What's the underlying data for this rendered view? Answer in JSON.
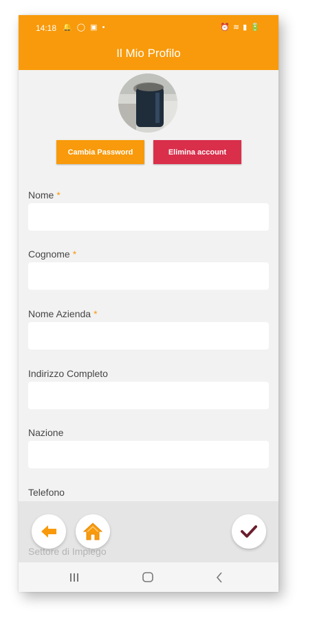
{
  "status_bar": {
    "time": "14:18",
    "left_icons": "🔔 ◯ ▣ •",
    "right_icons": "⏰ ≋ ▮ 🔋"
  },
  "header": {
    "title": "Il Mio Profilo"
  },
  "profile": {
    "change_password_label": "Cambia Password",
    "delete_account_label": "Elimina account"
  },
  "form": {
    "required_marker": "*",
    "fields": [
      {
        "label": "Nome",
        "required": true,
        "value": ""
      },
      {
        "label": "Cognome",
        "required": true,
        "value": ""
      },
      {
        "label": "Nome Azienda",
        "required": true,
        "value": ""
      },
      {
        "label": "Indirizzo Completo",
        "required": false,
        "value": ""
      },
      {
        "label": "Nazione",
        "required": false,
        "value": ""
      },
      {
        "label": "Telefono",
        "required": false,
        "value": ""
      },
      {
        "label": "Settore di Impiego",
        "required": false,
        "value": ""
      }
    ]
  },
  "actions": {
    "back_icon": "arrow-left-icon",
    "home_icon": "home-icon",
    "confirm_icon": "checkmark-icon"
  },
  "colors": {
    "accent": "#f89a0b",
    "danger": "#d92f4b",
    "confirm": "#6b1f2e"
  }
}
